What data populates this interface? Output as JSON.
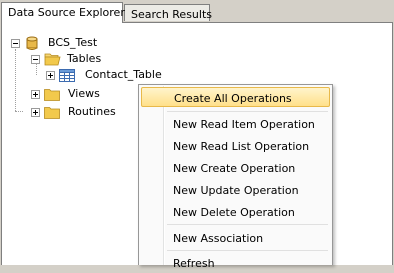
{
  "tabs": [
    {
      "label": "Data Source Explorer",
      "active": true
    },
    {
      "label": "Search Results",
      "active": false
    }
  ],
  "tree": {
    "root": {
      "label": "BCS_Test",
      "expanded": true
    },
    "tables": {
      "label": "Tables",
      "expanded": true
    },
    "contact_table": {
      "label": "Contact_Table",
      "expanded": false,
      "selected": true
    },
    "views": {
      "label": "Views",
      "expanded": false
    },
    "routines": {
      "label": "Routines",
      "expanded": false
    }
  },
  "context_menu": {
    "items": [
      {
        "label": "Create All Operations",
        "highlighted": true
      },
      {
        "label": "New Read Item Operation"
      },
      {
        "label": "New Read List Operation"
      },
      {
        "label": "New Create Operation"
      },
      {
        "label": "New Update Operation"
      },
      {
        "label": "New Delete Operation"
      },
      {
        "label": "New Association"
      },
      {
        "label": "Refresh"
      }
    ]
  },
  "colors": {
    "selection": "#3399ff",
    "menu_highlight": "#ffe08a",
    "folder": "#f2c94c",
    "database": "#e8b84a"
  }
}
